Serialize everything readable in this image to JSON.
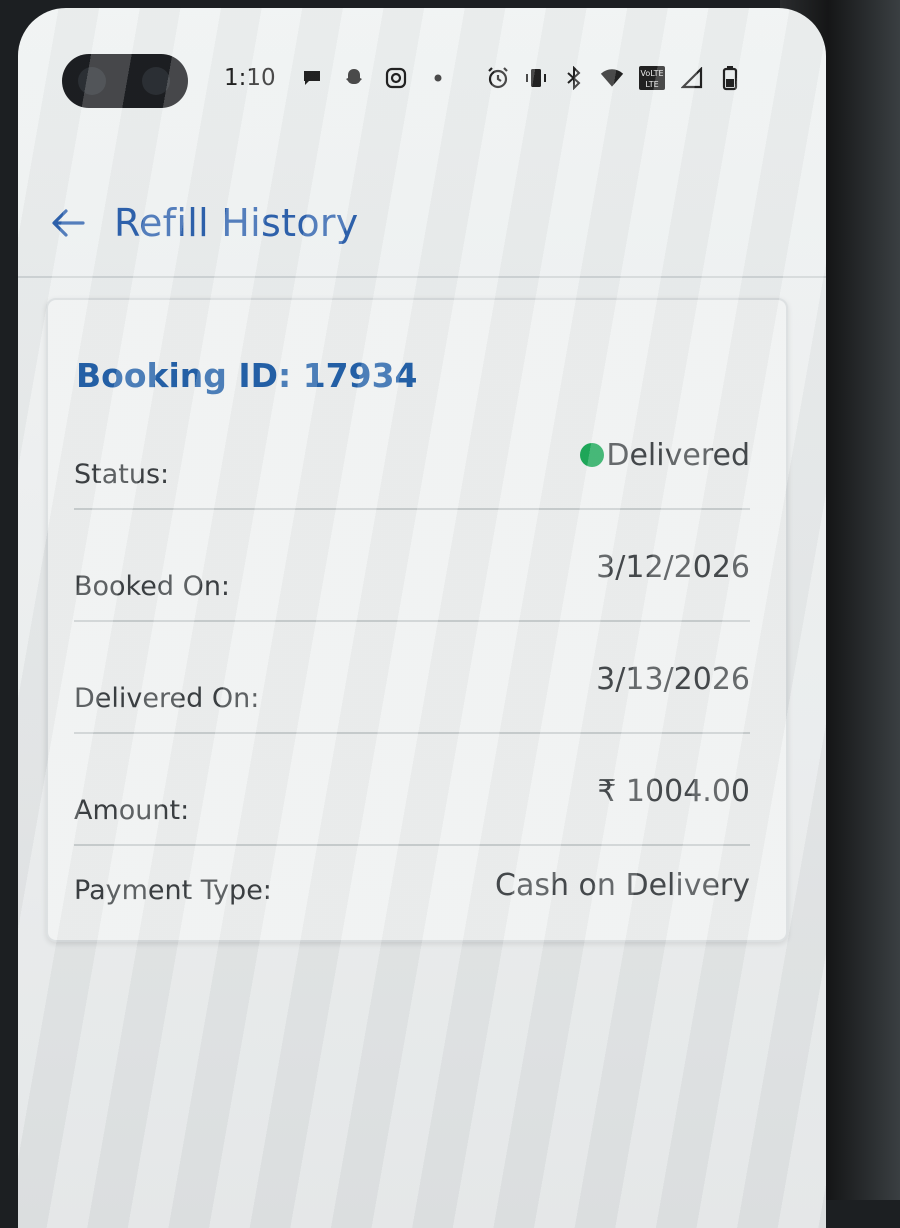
{
  "status_bar": {
    "time": "1:10",
    "left_icons": [
      "message-icon",
      "snapchat-icon",
      "instagram-icon",
      "dot-icon"
    ],
    "right_icons": [
      "alarm-icon",
      "vibrate-icon",
      "bluetooth-icon",
      "wifi-icon",
      "volte-icon",
      "signal-icon",
      "battery-icon"
    ],
    "volte_label": "VoLTE"
  },
  "header": {
    "title": "Refill History",
    "back_icon": "arrow-left-icon"
  },
  "booking": {
    "id_label": "Booking ID: 17934",
    "status_label": "Status:",
    "status_value": "Delivered",
    "status_color": "#1ea95a",
    "booked_on_label": "Booked On:",
    "booked_on_value": "3/12/2026",
    "delivered_on_label": "Delivered On:",
    "delivered_on_value": "3/13/2026",
    "amount_label": "Amount:",
    "amount_value": "₹ 1004.00",
    "payment_type_label": "Payment Type:",
    "payment_type_value": "Cash on Delivery"
  },
  "colors": {
    "accent": "#2e62ad",
    "booking_id": "#2461a8"
  }
}
